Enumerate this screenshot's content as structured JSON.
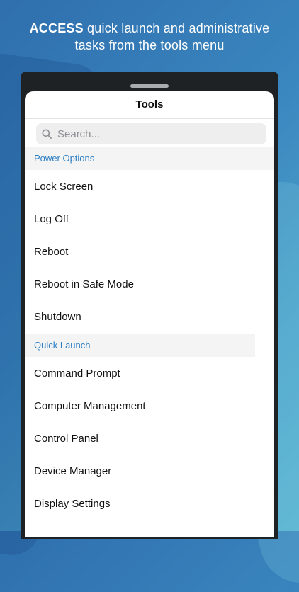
{
  "caption": {
    "bold": "ACCESS",
    "rest_line1": " quick launch and administrative",
    "line2": "tasks from the tools menu"
  },
  "sheet": {
    "title": "Tools"
  },
  "search": {
    "placeholder": "Search..."
  },
  "sections": [
    {
      "header": "Power Options",
      "items": [
        "Lock Screen",
        "Log Off",
        "Reboot",
        "Reboot in Safe Mode",
        "Shutdown"
      ]
    },
    {
      "header": "Quick Launch",
      "items": [
        "Command Prompt",
        "Computer Management",
        "Control Panel",
        "Device Manager",
        "Display Settings"
      ]
    }
  ],
  "colors": {
    "accent": "#2b7ec1",
    "background": "#3a86bf"
  },
  "icons": {
    "search": "magnifier-icon"
  }
}
